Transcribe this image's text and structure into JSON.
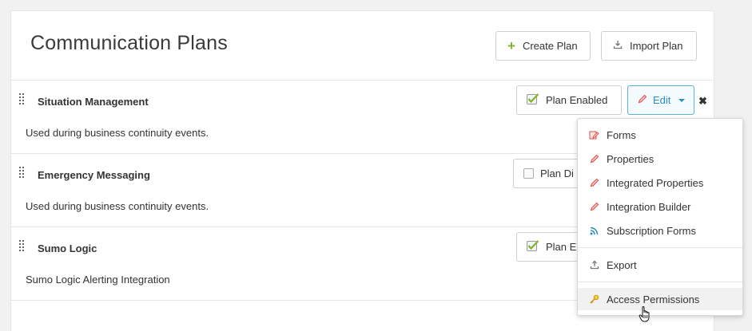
{
  "page": {
    "title": "Communication Plans"
  },
  "header": {
    "create_label": "Create Plan",
    "import_label": "Import Plan"
  },
  "plans": [
    {
      "name": "Situation Management",
      "description": "Used during business continuity events.",
      "status_label": "Plan Enabled",
      "enabled": true
    },
    {
      "name": "Emergency Messaging",
      "description": "Used during business continuity events.",
      "status_label": "Plan Di",
      "enabled": false
    },
    {
      "name": "Sumo Logic",
      "description": "Sumo Logic Alerting Integration",
      "status_label": "Plan E",
      "enabled": true
    }
  ],
  "edit": {
    "label": "Edit"
  },
  "menu": {
    "items": [
      {
        "label": "Forms",
        "icon": "form-edit-icon"
      },
      {
        "label": "Properties",
        "icon": "pencil-icon"
      },
      {
        "label": "Integrated Properties",
        "icon": "pencil-icon"
      },
      {
        "label": "Integration Builder",
        "icon": "pencil-icon"
      },
      {
        "label": "Subscription Forms",
        "icon": "rss-icon"
      },
      {
        "label": "Export",
        "icon": "export-icon"
      },
      {
        "label": "Access Permissions",
        "icon": "key-icon"
      }
    ],
    "hovered": "Access Permissions"
  },
  "colors": {
    "accent_blue": "#2b8dbe",
    "check_green": "#7db527",
    "pencil_red": "#d9534f"
  }
}
